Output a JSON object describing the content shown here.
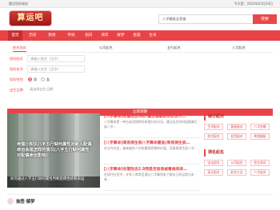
{
  "topbar": {
    "favorite": "重设您的易经",
    "date": "今天是：2024年03月24日"
  },
  "header": {
    "logo": "算运吧",
    "search_value": "八字精批全家福",
    "search_button": "搜索"
  },
  "nav": {
    "items": [
      "首页",
      "历史",
      "民俗",
      "传统",
      "剖白",
      "测年",
      "解梦",
      "星座",
      "生肖"
    ]
  },
  "form": {
    "tabs": [
      "姓名测试",
      "公司起名",
      "五行起名",
      "八字起名"
    ],
    "rows": [
      {
        "label": "您的姓氏",
        "placeholder": "请输入姓氏（汉字）"
      },
      {
        "label": "您的名字",
        "placeholder": "请输入名字（汉字）"
      }
    ],
    "gender": {
      "label": "您的性别",
      "options": [
        "男",
        "女"
      ]
    },
    "birth": {
      "label": "出生日期",
      "value": "请选择出生日期"
    },
    "submit": "立即测算"
  },
  "slider": {
    "overlay": "命理小知识八字五行缺何属性对新人配偶命运会是怎样的情况(八字五行缺何属性对配偶命运影响)",
    "caption": "如何通过八字五行缺何属性判断配偶性格和命运"
  },
  "articles": [
    {
      "title": "[八字算命]有冒险念5两7属否端联财务状况不…",
      "desc": "八字算命是一种古老而独特的命理分析方法，通过出生的时辰推算生辰八字…"
    },
    {
      "title": "[八字算命]周易测生辰八字算命最准(周易测生辰…",
      "desc": "在当今社会，越来越多人开始重视命理的价值，而周易测生辰八字…"
    },
    {
      "title": "[八字算命]有冒险念2.9两是否容易被看做来来…",
      "desc": "在现代社会中，许多人常常会通过八字算命来了解自己的运势与未来…"
    }
  ],
  "side": {
    "sections": [
      {
        "title": "缘分配对",
        "items": [
          "生肖配对",
          "星座配对",
          "八字合婚",
          "姓名配对",
          "血型配对",
          "属相婚配"
        ]
      },
      {
        "title": "测名起名",
        "items": [
          "宝宝起名",
          "公司起名",
          "姓名测试",
          "英文起名",
          "起名大全",
          "八字起名"
        ]
      }
    ]
  },
  "footer": {
    "section_title": "抽签·解梦"
  }
}
